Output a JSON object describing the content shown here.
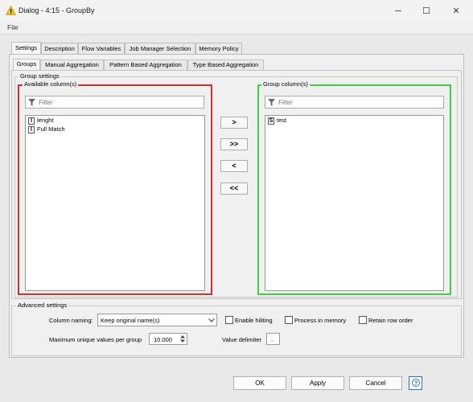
{
  "window": {
    "title": "Dialog - 4:15 - GroupBy",
    "minimize_glyph": "─",
    "maximize_glyph": "☐",
    "close_glyph": "✕"
  },
  "menu": {
    "file": "File"
  },
  "tabs": [
    "Settings",
    "Description",
    "Flow Variables",
    "Job Manager Selection",
    "Memory Policy"
  ],
  "subtabs": [
    "Groups",
    "Manual Aggregation",
    "Pattern Based Aggregation",
    "Type Based Aggregation"
  ],
  "group_settings": {
    "title": "Group settings",
    "available": {
      "title": "Available column(s)",
      "filter_placeholder": "Filter",
      "items": [
        {
          "type": "I",
          "name": "lenght"
        },
        {
          "type": "I",
          "name": "Full Match"
        }
      ]
    },
    "group": {
      "title": "Group column(s)",
      "filter_placeholder": "Filter",
      "items": [
        {
          "type": "S",
          "name": "test"
        }
      ]
    },
    "move_buttons": [
      ">",
      ">>",
      "<",
      "<<"
    ]
  },
  "advanced": {
    "title": "Advanced settings",
    "column_naming_label": "Column naming:",
    "column_naming_value": "Keep original name(s)",
    "enable_hiliting": "Enable hiliting",
    "process_in_memory": "Process in memory",
    "retain_row_order": "Retain row order",
    "max_unique_label": "Maximum unique values per group",
    "max_unique_value": "10.000",
    "value_delimiter_label": "Value delimiter",
    "value_delimiter_value": ","
  },
  "buttons": {
    "ok": "OK",
    "apply": "Apply",
    "cancel": "Cancel",
    "help": "?"
  },
  "colors": {
    "available_border": "#d32f2f",
    "group_border": "#3fcf3f",
    "help_accent": "#1e73c8"
  },
  "icons": {
    "warning": "warning-icon",
    "filter": "filter-icon",
    "dropdown": "chevron-down-icon",
    "spinner": "spinner-arrows-icon"
  }
}
